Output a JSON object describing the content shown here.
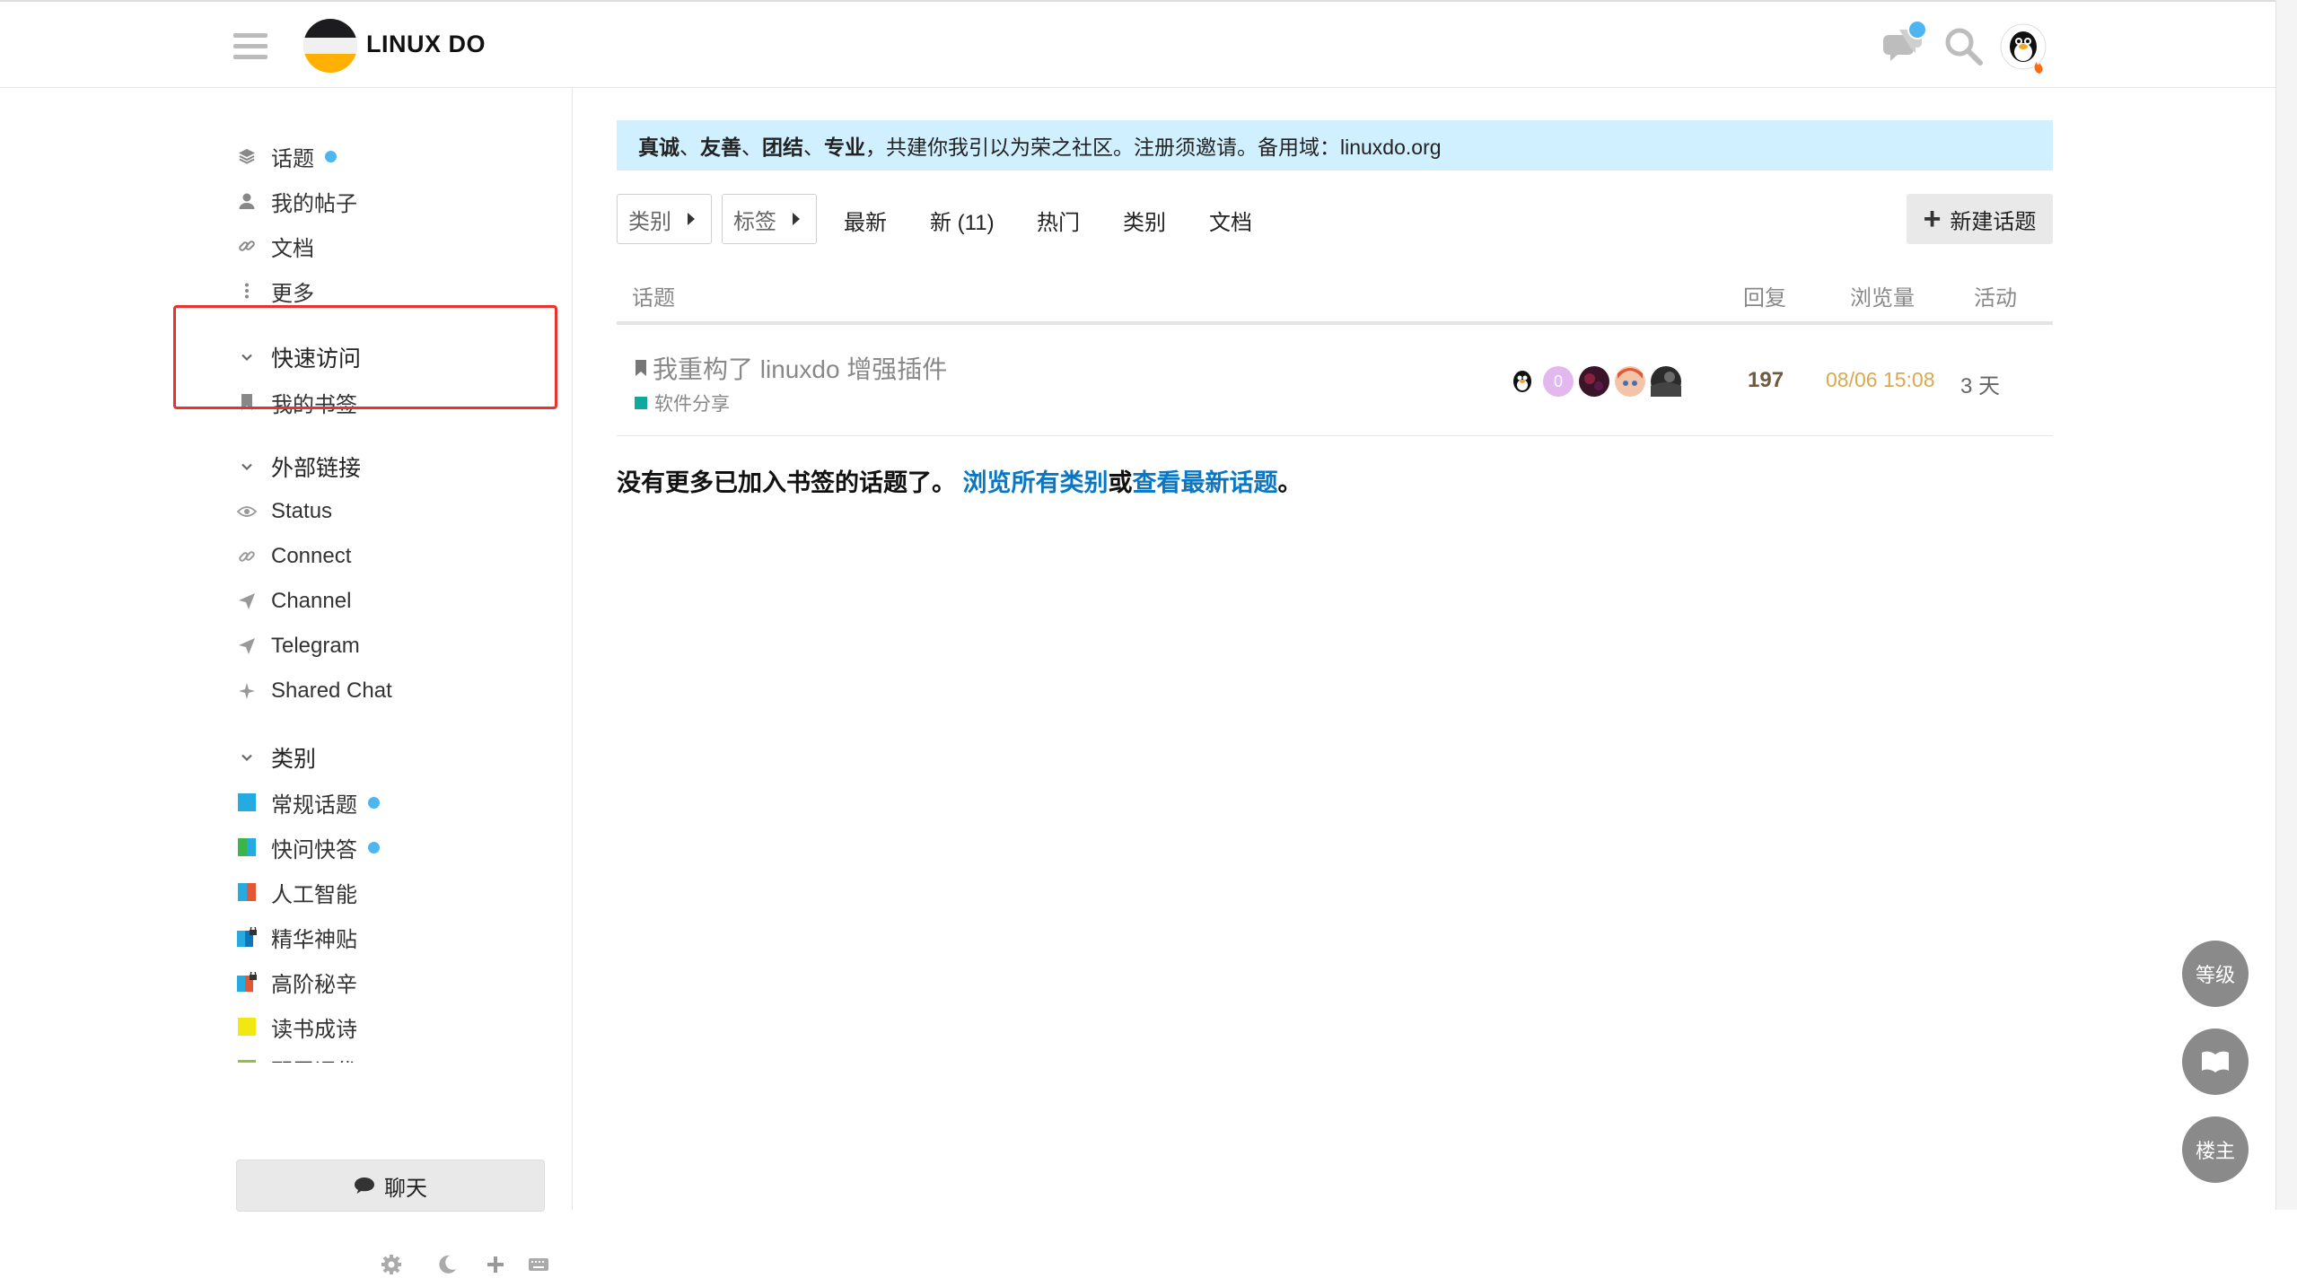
{
  "header": {
    "site_name": "LINUX DO"
  },
  "sidebar": {
    "main": [
      {
        "label": "话题",
        "icon": "layers-icon",
        "unread_dot": true
      },
      {
        "label": "我的帖子",
        "icon": "user-icon"
      },
      {
        "label": "文档",
        "icon": "link-icon"
      },
      {
        "label": "更多",
        "icon": "more-vertical-icon"
      }
    ],
    "quick_access": {
      "title": "快速访问",
      "items": [
        {
          "label": "我的书签",
          "icon": "bookmark-icon"
        }
      ]
    },
    "external_links": {
      "title": "外部链接",
      "items": [
        {
          "label": "Status",
          "icon": "eye-icon"
        },
        {
          "label": "Connect",
          "icon": "link-icon"
        },
        {
          "label": "Channel",
          "icon": "paper-plane-icon"
        },
        {
          "label": "Telegram",
          "icon": "paper-plane-icon"
        },
        {
          "label": "Shared Chat",
          "icon": "sparkle-icon"
        }
      ]
    },
    "categories": {
      "title": "类别",
      "items": [
        {
          "label": "常规话题",
          "colors": [
            "#25aae1"
          ],
          "unread_dot": true
        },
        {
          "label": "快问快答",
          "colors": [
            "#3ab54a",
            "#25aae1"
          ],
          "unread_dot": true
        },
        {
          "label": "人工智能",
          "colors": [
            "#25aae1",
            "#e45735"
          ]
        },
        {
          "label": "精华神贴",
          "colors": [
            "#25aae1",
            "#0e76bd"
          ],
          "locked": true
        },
        {
          "label": "高阶秘辛",
          "colors": [
            "#25aae1",
            "#e45735"
          ],
          "locked": true
        },
        {
          "label": "读书成诗",
          "colors": [
            "#f1e711"
          ]
        },
        {
          "label": "配置调优",
          "colors": [
            "#92c13e"
          ]
        }
      ]
    },
    "chat_button": "聊天"
  },
  "banner": {
    "bold_words": [
      "真诚",
      "友善",
      "团结",
      "专业"
    ],
    "separator": "、",
    "text": "，共建你我引以为荣之社区。注册须邀请。备用域：linuxdo.org"
  },
  "nav": {
    "category_dropdown": "类别",
    "tag_dropdown": "标签",
    "links": [
      "最新",
      "新 (11)",
      "热门",
      "类别",
      "文档"
    ],
    "new_topic": "新建话题"
  },
  "table": {
    "headers": {
      "topic": "话题",
      "replies": "回复",
      "views": "浏览量",
      "activity": "活动"
    },
    "rows": [
      {
        "title": "我重构了 linuxdo 增强插件",
        "category": "软件分享",
        "category_color": "#12a89d",
        "replies": "197",
        "views": "08/06 15:08",
        "activity": "3 天",
        "poster_letter": "0"
      }
    ]
  },
  "footer_message": {
    "prefix": "没有更多已加入书签的话题了。",
    "link1": "浏览所有类别",
    "middle": "或",
    "link2": "查看最新话题",
    "suffix": "。"
  },
  "floating": {
    "level": "等级",
    "owner": "楼主"
  },
  "colors": {
    "banner_bg": "#d1f0ff",
    "unread_dot": "#4db6f0",
    "link": "#0b77c3",
    "highlight_box": "#e8322f"
  }
}
